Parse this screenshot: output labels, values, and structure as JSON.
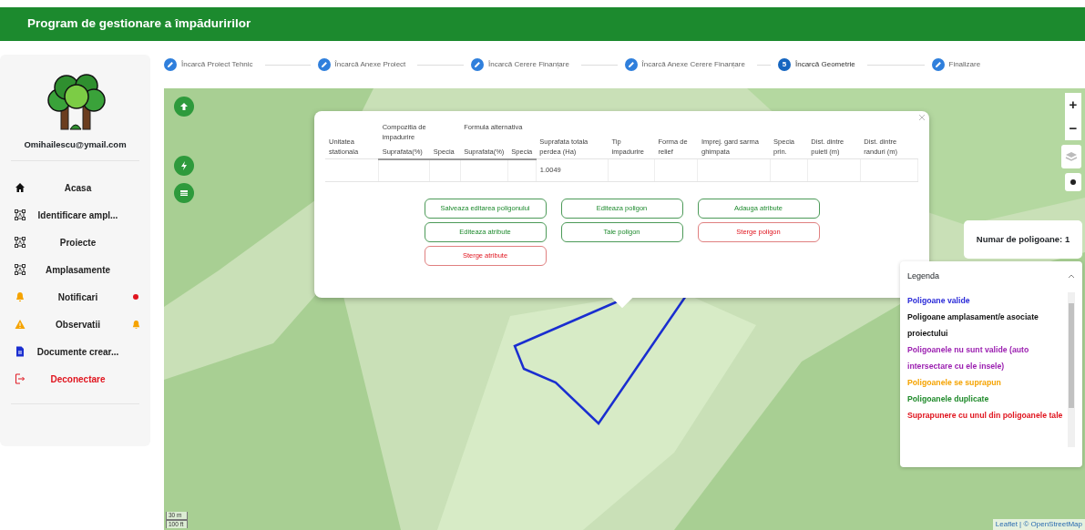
{
  "header": {
    "title": "Program de gestionare a împăduririlor"
  },
  "sidebar": {
    "email": "Omihailescu@ymail.com",
    "items": [
      {
        "label": "Acasa",
        "unread": false,
        "pending": false,
        "danger": false
      },
      {
        "label": "Identificare ampl...",
        "unread": false,
        "pending": false,
        "danger": false
      },
      {
        "label": "Proiecte",
        "unread": false,
        "pending": false,
        "danger": false
      },
      {
        "label": "Amplasamente",
        "unread": false,
        "pending": false,
        "danger": false
      },
      {
        "label": "Notificari",
        "unread": true,
        "pending": false,
        "danger": false
      },
      {
        "label": "Observatii",
        "unread": false,
        "pending": true,
        "danger": false
      },
      {
        "label": "Documente crear...",
        "unread": false,
        "pending": false,
        "danger": false
      },
      {
        "label": "Deconectare",
        "unread": false,
        "pending": false,
        "danger": true
      }
    ]
  },
  "stepper": [
    {
      "label": "Încarcă Proiect Tehnic",
      "kind": "done",
      "selected": false
    },
    {
      "label": "Încarcă Anexe Proiect",
      "kind": "done",
      "selected": false
    },
    {
      "label": "Încarcă Cerere Finanțare",
      "kind": "done",
      "selected": false
    },
    {
      "label": "Încarcă Anexe Cerere Finanțare",
      "kind": "done",
      "selected": false
    },
    {
      "label": "Încarcă Geometrie",
      "kind": "active",
      "number": "5",
      "selected": true
    },
    {
      "label": "Finalizare",
      "kind": "done",
      "selected": false
    }
  ],
  "map": {
    "zoom_in": "+",
    "zoom_out": "−",
    "scale": [
      "30 m",
      "100 ft"
    ],
    "attribution": "Leaflet | © OpenStreetMap",
    "polygon_count": "Numar de poligoane: 1",
    "popup": {
      "table": {
        "header_groups": [
          {
            "label": "Unitatea stationala"
          },
          {
            "label": "Compozitia de impadurire",
            "sub_columns": [
              "Suprafata(%)",
              "Specia"
            ]
          },
          {
            "label": "Formula alternativa",
            "sub_columns": [
              "Suprafata(%)",
              "Specia"
            ]
          },
          {
            "label": "Suprafata totala perdea (Ha)"
          },
          {
            "label": "Tip impadurire"
          },
          {
            "label": "Forma de relief"
          },
          {
            "label": "Imprej. gard sarma ghimpata"
          },
          {
            "label": "Specia prin."
          },
          {
            "label": "Dist. dintre puieti (m)"
          },
          {
            "label": "Dist. dintre randuri (m)"
          }
        ],
        "rows": [
          {
            "cells": [
              null,
              null,
              null,
              null,
              null,
              "1.0049",
              null,
              null,
              null,
              null,
              null,
              null
            ]
          }
        ]
      },
      "buttons": [
        {
          "label": "Salveaza editarea poligonului",
          "kind": "success"
        },
        {
          "label": "Editeaza poligon",
          "kind": "success"
        },
        {
          "label": "Adauga atribute",
          "kind": "success"
        },
        {
          "label": "Editeaza atribute",
          "kind": "success"
        },
        {
          "label": "Taie poligon",
          "kind": "success"
        },
        {
          "label": "Sterge poligon",
          "kind": "danger"
        },
        {
          "label": "Sterge atribute",
          "kind": "danger"
        }
      ]
    },
    "legend": {
      "title": "Legenda",
      "expanded": true,
      "items": [
        {
          "label": "Poligoane valide",
          "color": "#2a2ad8"
        },
        {
          "label": "Poligoane amplasament/e asociate proiectului",
          "color": "#111111"
        },
        {
          "label": "Poligoanele nu sunt valide (auto intersectare cu ele insele)",
          "color": "#9b1fb0"
        },
        {
          "label": "Poligoanele se suprapun",
          "color": "#f5a300"
        },
        {
          "label": "Poligoanele duplicate",
          "color": "#1f8a2a"
        },
        {
          "label": "Suprapunere cu unul din poligoanele tale",
          "color": "#e0141e"
        }
      ]
    }
  }
}
